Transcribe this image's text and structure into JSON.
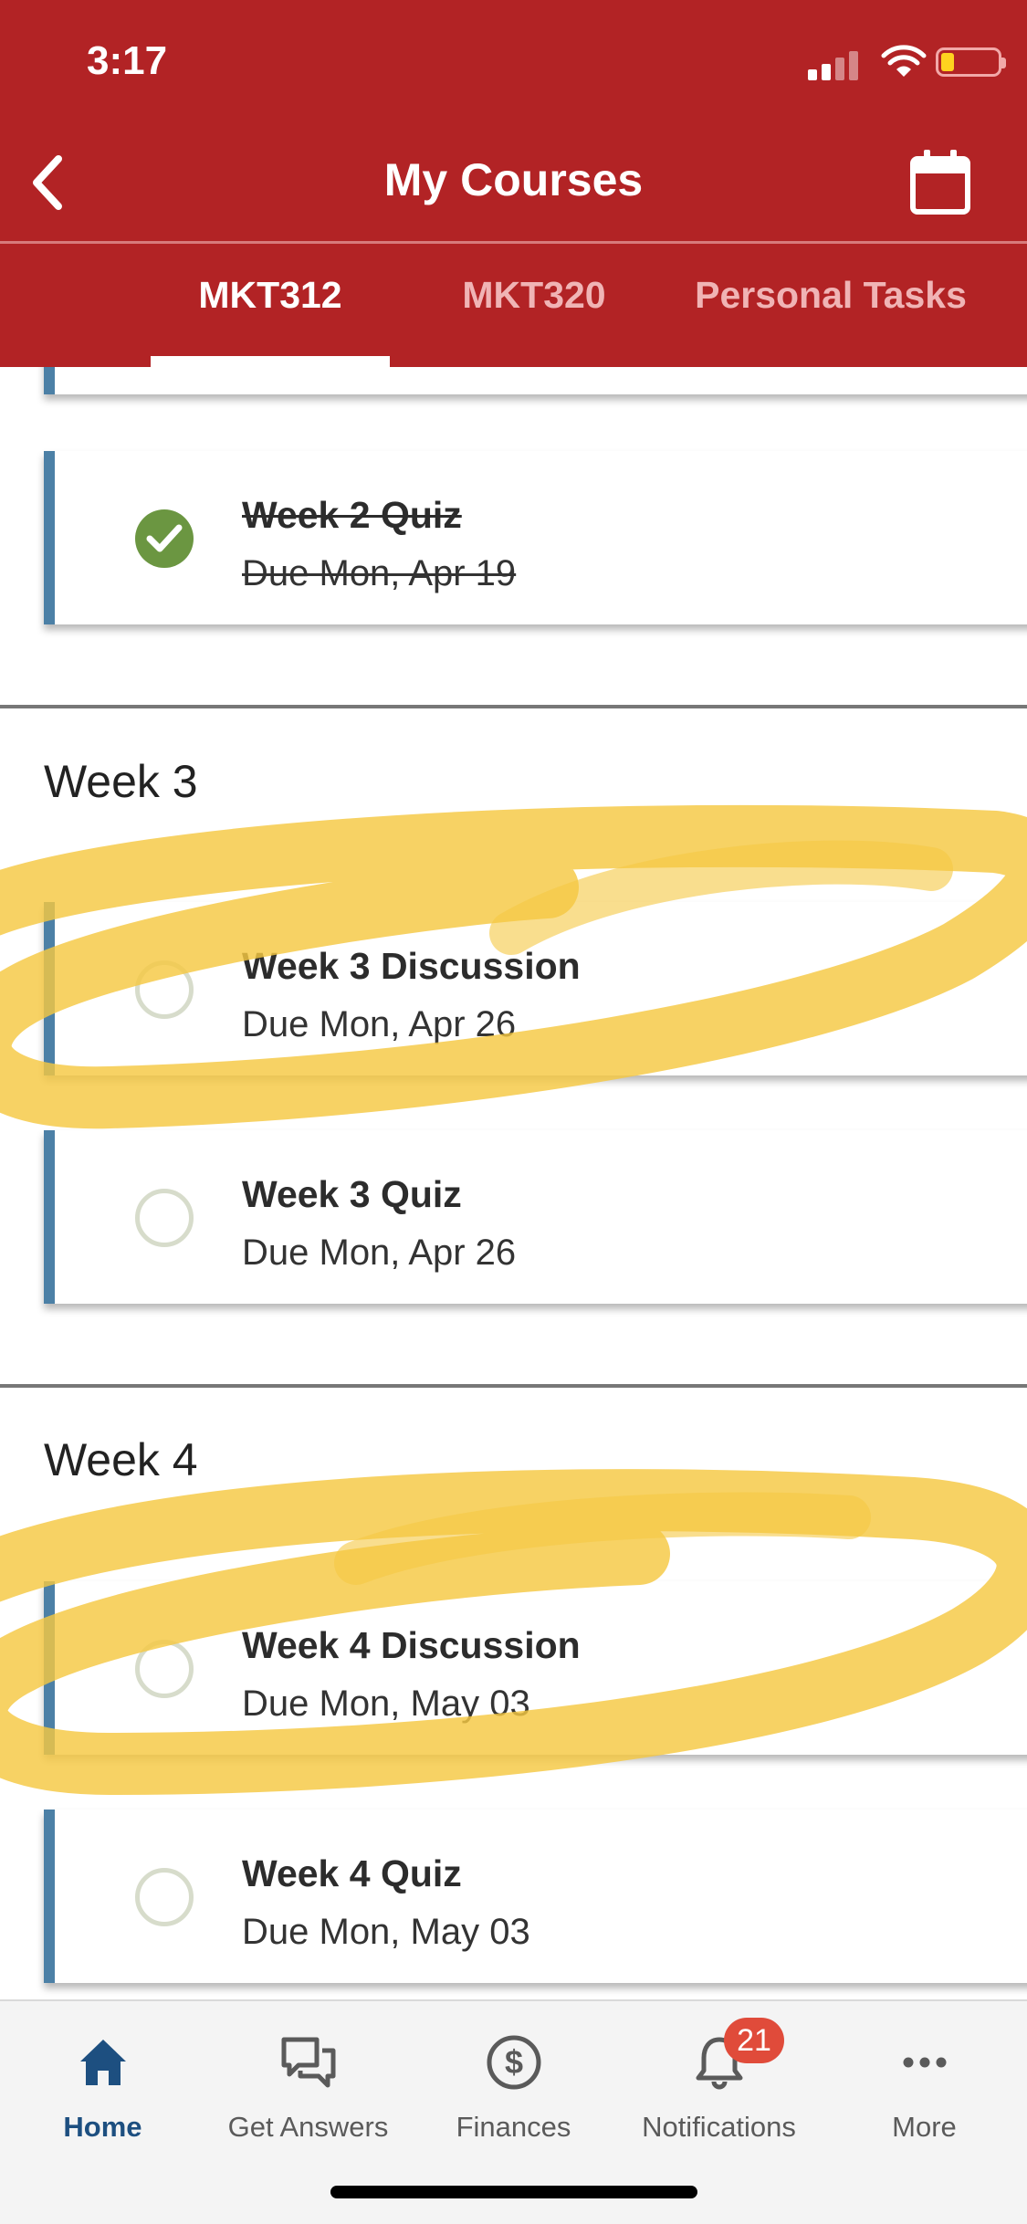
{
  "status_bar": {
    "time": "3:17"
  },
  "header": {
    "title": "My Courses"
  },
  "tabs": [
    {
      "label": "MKT312",
      "active": true
    },
    {
      "label": "MKT320",
      "active": false
    },
    {
      "label": "Personal Tasks",
      "active": false
    }
  ],
  "tasks": {
    "week2_quiz": {
      "title": "Week 2 Quiz",
      "due": "Due Mon, Apr 19",
      "completed": true
    }
  },
  "weeks": [
    {
      "header": "Week 3",
      "items": [
        {
          "title": "Week 3 Discussion",
          "due": "Due Mon, Apr 26",
          "completed": false
        },
        {
          "title": "Week 3 Quiz",
          "due": "Due Mon, Apr 26",
          "completed": false
        }
      ]
    },
    {
      "header": "Week 4",
      "items": [
        {
          "title": "Week 4 Discussion",
          "due": "Due Mon, May 03",
          "completed": false
        },
        {
          "title": "Week 4 Quiz",
          "due": "Due Mon, May 03",
          "completed": false
        }
      ]
    }
  ],
  "bottom_nav": {
    "items": [
      {
        "label": "Home",
        "icon": "home-icon",
        "active": true
      },
      {
        "label": "Get Answers",
        "icon": "chat-icon",
        "active": false
      },
      {
        "label": "Finances",
        "icon": "dollar-icon",
        "active": false
      },
      {
        "label": "Notifications",
        "icon": "bell-icon",
        "active": false,
        "badge": "21"
      },
      {
        "label": "More",
        "icon": "more-icon",
        "active": false
      }
    ]
  },
  "colors": {
    "header_red": "#b22325",
    "card_accent": "#4c80a6",
    "complete_green": "#6b9641",
    "active_nav": "#1d4f80",
    "badge": "#e04b3a",
    "highlight": "#f5c842"
  }
}
